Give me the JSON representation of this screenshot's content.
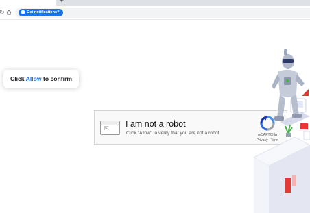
{
  "browser": {
    "tab_title": "cha",
    "tab_close_icon": "close-icon",
    "new_tab_icon": "plus-icon",
    "notification_chip": "Get notifications?"
  },
  "page": {
    "confirm": {
      "prefix": "Click",
      "allow": "Allow",
      "suffix": "to confirm"
    },
    "captcha": {
      "title": "I am not a robot",
      "subtitle": "Click \"Allow\" to verify that you are not a robot",
      "brand": "reCAPTCHA",
      "links": "Privacy - Term"
    }
  },
  "colors": {
    "accent": "#1a73e8",
    "chrome_bg": "#dee1e6",
    "captcha_bg": "#f9f9f9"
  }
}
